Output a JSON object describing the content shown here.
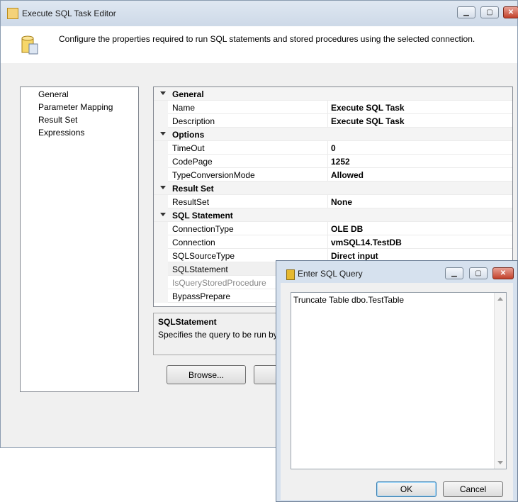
{
  "main_window": {
    "title": "Execute SQL Task Editor",
    "header_text": "Configure the properties required to run SQL statements and stored procedures using the selected connection."
  },
  "left_nav": {
    "items": [
      "General",
      "Parameter Mapping",
      "Result Set",
      "Expressions"
    ]
  },
  "property_grid": {
    "categories": {
      "general": "General",
      "options": "Options",
      "result_set": "Result Set",
      "sql_statement": "SQL Statement"
    },
    "rows": {
      "name": {
        "label": "Name",
        "value": "Execute SQL Task"
      },
      "description": {
        "label": "Description",
        "value": "Execute SQL Task"
      },
      "timeout": {
        "label": "TimeOut",
        "value": "0"
      },
      "codepage": {
        "label": "CodePage",
        "value": "1252"
      },
      "typeconversion": {
        "label": "TypeConversionMode",
        "value": "Allowed"
      },
      "resultset": {
        "label": "ResultSet",
        "value": "None"
      },
      "connectiontype": {
        "label": "ConnectionType",
        "value": "OLE DB"
      },
      "connection": {
        "label": "Connection",
        "value": "vmSQL14.TestDB"
      },
      "sqlsourcetype": {
        "label": "SQLSourceType",
        "value": "Direct input"
      },
      "sqlstatement": {
        "label": "SQLStatement",
        "value": ""
      },
      "isquerystoredprocedure": {
        "label": "IsQueryStoredProcedure",
        "value": ""
      },
      "bypassprepare": {
        "label": "BypassPrepare",
        "value": ""
      }
    }
  },
  "description_box": {
    "title": "SQLStatement",
    "text": "Specifies the query to be run by"
  },
  "buttons": {
    "browse": "Browse..."
  },
  "dialog": {
    "title": "Enter SQL Query",
    "query_text": "Truncate Table dbo.TestTable",
    "ok": "OK",
    "cancel": "Cancel"
  }
}
